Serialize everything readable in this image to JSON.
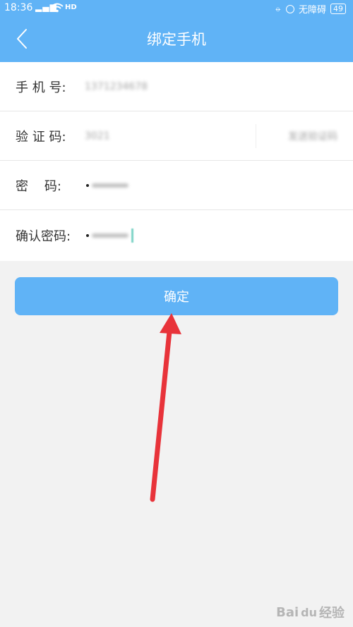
{
  "status_bar": {
    "time": "18:36",
    "signal": "4G",
    "hd": "HD",
    "no_disturb": "无障碍",
    "battery": "49"
  },
  "header": {
    "title": "绑定手机",
    "back_icon": "chevron-left-icon"
  },
  "form": {
    "phone_label": "手 机 号:",
    "code_label": "验 证 码:",
    "send_code_label": "发送验证码",
    "password_label": "密    码:",
    "confirm_password_label": "确认密码:",
    "phone_value": "1371234678",
    "code_value": "3021"
  },
  "confirm_button": {
    "label": "确定"
  },
  "watermark": {
    "text": "Bai",
    "paw": "du",
    "suffix": "经验"
  },
  "colors": {
    "primary": "#60b3f6",
    "arrow": "#e8333a",
    "background": "#f2f2f2"
  }
}
